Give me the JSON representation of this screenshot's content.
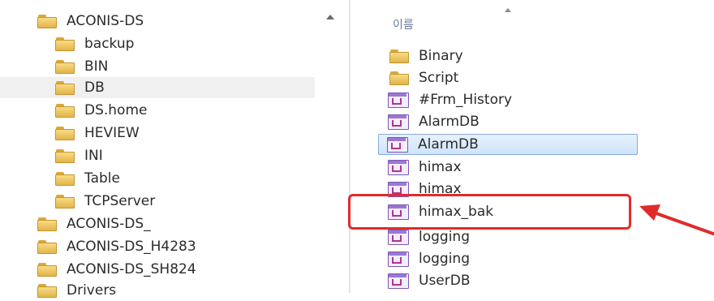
{
  "tree": {
    "items": [
      {
        "label": "ACONIS-DS",
        "level": 0
      },
      {
        "label": "backup",
        "level": 1
      },
      {
        "label": "BIN",
        "level": 1
      },
      {
        "label": "DB",
        "level": 1,
        "selected": true
      },
      {
        "label": "DS.home",
        "level": 1
      },
      {
        "label": "HEVIEW",
        "level": 1
      },
      {
        "label": "INI",
        "level": 1
      },
      {
        "label": "Table",
        "level": 1
      },
      {
        "label": "TCPServer",
        "level": 1
      },
      {
        "label": "ACONIS-DS_",
        "level": 0
      },
      {
        "label": "ACONIS-DS_H4283",
        "level": 0
      },
      {
        "label": "ACONIS-DS_SH824",
        "level": 0
      },
      {
        "label": "Drivers",
        "level": 0
      }
    ]
  },
  "file_list": {
    "column_header": "이름",
    "items": [
      {
        "label": "Binary",
        "icon": "folder-icon"
      },
      {
        "label": "Script",
        "icon": "folder-icon"
      },
      {
        "label": "#Frm_History",
        "icon": "database-file-icon"
      },
      {
        "label": "AlarmDB",
        "icon": "database-file-icon"
      },
      {
        "label": "AlarmDB",
        "icon": "database-file-icon",
        "selected": true
      },
      {
        "label": "himax",
        "icon": "database-file-icon"
      },
      {
        "label": "himax",
        "icon": "database-file-icon"
      },
      {
        "label": "himax_bak",
        "icon": "database-file-icon",
        "highlighted": true
      },
      {
        "label": "logging",
        "icon": "database-file-icon"
      },
      {
        "label": "logging",
        "icon": "database-file-icon"
      },
      {
        "label": "UserDB",
        "icon": "database-file-icon"
      }
    ]
  },
  "colors": {
    "annotation": "#e02b2b",
    "selection": "#cfe3fb",
    "folder": "#e3b44a",
    "db_icon": "#7a56b7"
  }
}
